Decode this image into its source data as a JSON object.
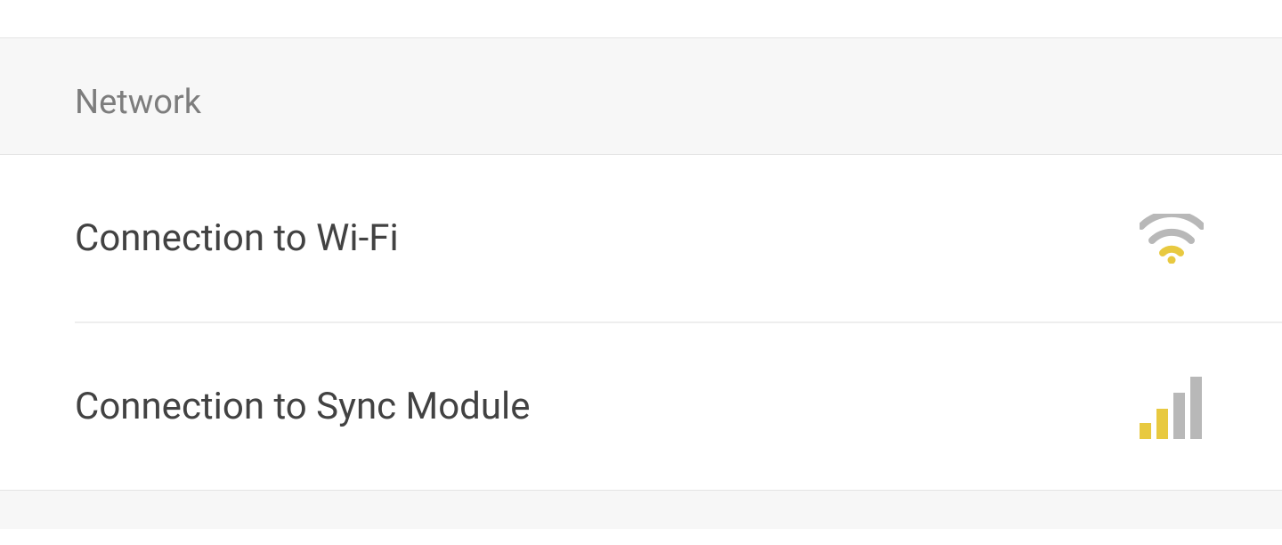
{
  "section": {
    "title": "Network"
  },
  "items": [
    {
      "label": "Connection to Wi-Fi",
      "icon": "wifi-icon",
      "signalLevel": 1
    },
    {
      "label": "Connection to Sync Module",
      "icon": "signal-bars-icon",
      "signalLevel": 2
    }
  ],
  "colors": {
    "active": "#e8c940",
    "inactive": "#b8b8b8"
  }
}
